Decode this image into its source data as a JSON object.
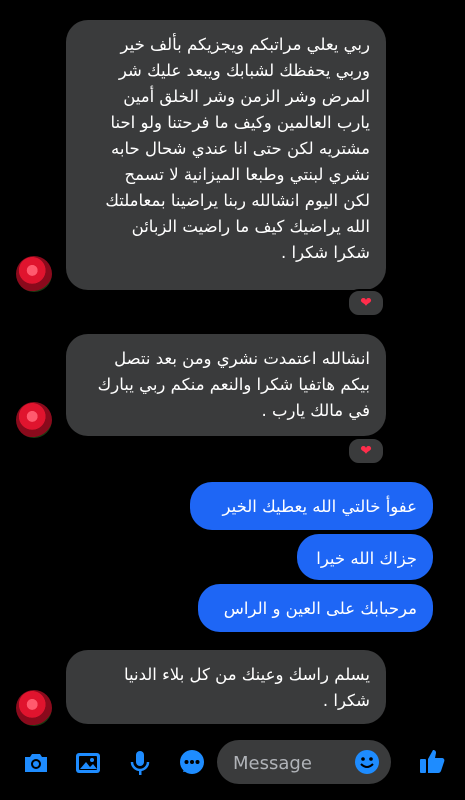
{
  "messages": [
    {
      "direction": "incoming",
      "text": "ربي يعلي  مراتبكم ويجزيكم بألف خير\nوربي يحفظك لشبابك ويبعد عليك شر\nالمرض وشر الزمن وشر الخلق أمين\nيارب العالمين وكيف ما فرحتنا ولو احنا\nمشتريه لكن حتى انا عندي شحال حابه\nنشري لبنتي وطبعا الميزانية لا تسمح\nلكن اليوم انشالله ربنا يراضينا بمعاملتك\nالله يراضيك كيف ما راضيت الزبائن\nشكرا شكرا .",
      "reaction": "❤"
    },
    {
      "direction": "incoming",
      "text": "انشالله اعتمدت نشري ومن بعد نتصل\nبيكم هاتفيا شكرا والنعم منكم ربي يبارك\nفي مالك يارب .",
      "reaction": "❤"
    },
    {
      "direction": "outgoing",
      "text": "عفوأ خالتي الله يعطيك الخير"
    },
    {
      "direction": "outgoing",
      "text": "جزاك الله خيرا"
    },
    {
      "direction": "outgoing",
      "text": "مرحبابك على العين و الراس"
    },
    {
      "direction": "incoming",
      "text": "يسلم راسك وعينك من كل بلاء الدنيا\nشكرا ."
    }
  ],
  "composer": {
    "placeholder": "Message",
    "icons": [
      "camera-icon",
      "image-icon",
      "microphone-icon",
      "chat-apps-icon",
      "emoji-icon",
      "thumbs-up-icon"
    ]
  },
  "colors": {
    "background": "#000000",
    "incoming_bubble": "#3a3b3c",
    "outgoing_bubble": "#1e66f5",
    "icon_blue": "#1e8cff",
    "heart": "#ff2d4b"
  }
}
